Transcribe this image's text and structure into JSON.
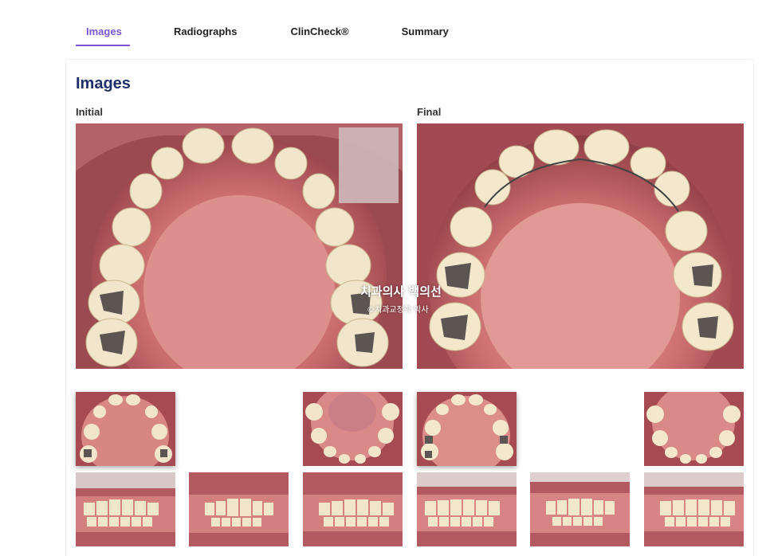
{
  "tabs": [
    {
      "label": "Images",
      "active": true
    },
    {
      "label": "Radiographs",
      "active": false
    },
    {
      "label": "ClinCheck®",
      "active": false
    },
    {
      "label": "Summary",
      "active": false
    }
  ],
  "section": {
    "title": "Images",
    "initial_label": "Initial",
    "final_label": "Final"
  },
  "watermark": {
    "line1": "치과의사 백의선",
    "line2": "©치과교정학 박사"
  },
  "colors": {
    "accent": "#7b55d6",
    "heading": "#1f2f6b",
    "gum": "#c15d63",
    "tooth": "#efe6cf"
  },
  "thumbnails": [
    {
      "icon": "upper-occlusal-photo",
      "selected": true
    },
    {
      "icon": "lower-occlusal-photo",
      "selected": false
    },
    {
      "icon": "upper-occlusal-photo",
      "selected": true
    },
    {
      "icon": "lower-occlusal-photo",
      "selected": false
    },
    {
      "icon": "right-buccal-photo",
      "selected": false
    },
    {
      "icon": "anterior-photo",
      "selected": false
    },
    {
      "icon": "left-buccal-photo",
      "selected": false
    },
    {
      "icon": "right-buccal-photo",
      "selected": false
    },
    {
      "icon": "anterior-photo",
      "selected": false
    },
    {
      "icon": "left-buccal-photo",
      "selected": false
    }
  ]
}
